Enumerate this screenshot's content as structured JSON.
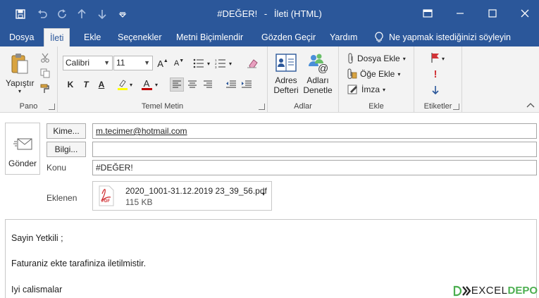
{
  "window": {
    "title": "#DEĞER!",
    "separator": "-",
    "subtitle": "İleti (HTML)"
  },
  "quick_access": {
    "icons": [
      "save-icon",
      "undo-icon",
      "redo-icon",
      "up-arrow-icon",
      "down-arrow-icon",
      "customize-icon"
    ]
  },
  "tabs": [
    {
      "label": "Dosya"
    },
    {
      "label": "İleti"
    },
    {
      "label": "Ekle"
    },
    {
      "label": "Seçenekler"
    },
    {
      "label": "Metni Biçimlendir"
    },
    {
      "label": "Gözden Geçir"
    },
    {
      "label": "Yardım"
    }
  ],
  "tell_me": "Ne yapmak istediğinizi söyleyin",
  "ribbon": {
    "clipboard": {
      "label": "Pano",
      "paste": "Yapıştır"
    },
    "basic_text": {
      "label": "Temel Metin",
      "font": "Calibri",
      "size": "11",
      "grow": "A",
      "shrink": "A",
      "bold": "K",
      "italic": "T",
      "underline": "A",
      "font_color": "A"
    },
    "names": {
      "label": "Adlar",
      "address_book_1": "Adres",
      "address_book_2": "Defteri",
      "check_names_1": "Adları",
      "check_names_2": "Denetle"
    },
    "include": {
      "label": "Ekle",
      "attach_file": "Dosya Ekle",
      "attach_item": "Öğe Ekle",
      "signature": "İmza"
    },
    "tags": {
      "label": "Etiketler"
    }
  },
  "compose": {
    "send": "Gönder",
    "to_button": "Kime...",
    "to_value": "m.tecimer@hotmail.com",
    "cc_button": "Bilgi...",
    "cc_value": "",
    "subject_label": "Konu",
    "subject_value": "#DEĞER!",
    "attached_label": "Eklenen",
    "attachment": {
      "name": "2020_1001-31.12.2019 23_39_56.pdf",
      "size": "115 KB",
      "icon_text": "PDF"
    }
  },
  "body": {
    "line1": "Sayin Yetkili ;",
    "line2": "Faturaniz ekte tarafiniza iletilmistir.",
    "line3": "Iyi calismalar"
  },
  "watermark": {
    "part1": "EXCEL",
    "part2": "DEPO"
  },
  "colors": {
    "brand": "#2b579a",
    "ribbon": "#f3f3f3",
    "font_red": "#c00000",
    "highlight": "#ffff00"
  }
}
